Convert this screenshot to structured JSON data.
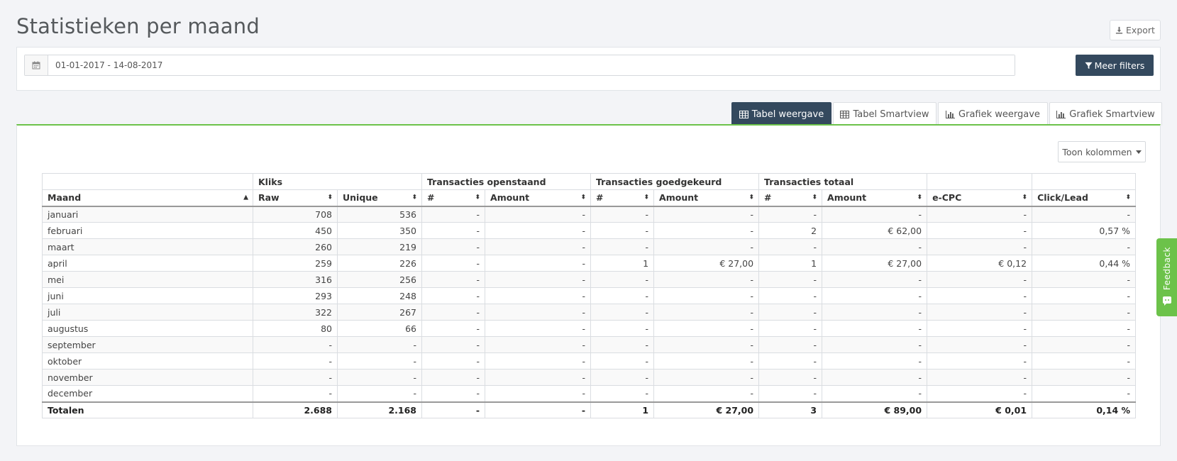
{
  "page": {
    "title": "Statistieken per maand",
    "export_label": "Export"
  },
  "filters": {
    "date_range": "01-01-2017 - 14-08-2017",
    "more_filters_label": "Meer filters"
  },
  "tabs": [
    {
      "label": "Tabel weergave",
      "icon": "table-icon",
      "active": true
    },
    {
      "label": "Tabel Smartview",
      "icon": "table-icon",
      "active": false
    },
    {
      "label": "Grafiek weergave",
      "icon": "bar-chart-icon",
      "active": false
    },
    {
      "label": "Grafiek Smartview",
      "icon": "bar-chart-icon",
      "active": false
    }
  ],
  "columns_button_label": "Toon kolommen",
  "table": {
    "groups": {
      "kliks": "Kliks",
      "open": "Transacties openstaand",
      "approved": "Transacties goedgekeurd",
      "total": "Transacties totaal"
    },
    "headers": [
      "Maand",
      "Raw",
      "Unique",
      "#",
      "Amount",
      "#",
      "Amount",
      "#",
      "Amount",
      "e-CPC",
      "Click/Lead"
    ],
    "rows": [
      [
        "januari",
        "708",
        "536",
        "-",
        "-",
        "-",
        "-",
        "-",
        "-",
        "-",
        "-"
      ],
      [
        "februari",
        "450",
        "350",
        "-",
        "-",
        "-",
        "-",
        "2",
        "€ 62,00",
        "-",
        "0,57 %"
      ],
      [
        "maart",
        "260",
        "219",
        "-",
        "-",
        "-",
        "-",
        "-",
        "-",
        "-",
        "-"
      ],
      [
        "april",
        "259",
        "226",
        "-",
        "-",
        "1",
        "€ 27,00",
        "1",
        "€ 27,00",
        "€ 0,12",
        "0,44 %"
      ],
      [
        "mei",
        "316",
        "256",
        "-",
        "-",
        "-",
        "-",
        "-",
        "-",
        "-",
        "-"
      ],
      [
        "juni",
        "293",
        "248",
        "-",
        "-",
        "-",
        "-",
        "-",
        "-",
        "-",
        "-"
      ],
      [
        "juli",
        "322",
        "267",
        "-",
        "-",
        "-",
        "-",
        "-",
        "-",
        "-",
        "-"
      ],
      [
        "augustus",
        "80",
        "66",
        "-",
        "-",
        "-",
        "-",
        "-",
        "-",
        "-",
        "-"
      ],
      [
        "september",
        "-",
        "-",
        "-",
        "-",
        "-",
        "-",
        "-",
        "-",
        "-",
        "-"
      ],
      [
        "oktober",
        "-",
        "-",
        "-",
        "-",
        "-",
        "-",
        "-",
        "-",
        "-",
        "-"
      ],
      [
        "november",
        "-",
        "-",
        "-",
        "-",
        "-",
        "-",
        "-",
        "-",
        "-",
        "-"
      ],
      [
        "december",
        "-",
        "-",
        "-",
        "-",
        "-",
        "-",
        "-",
        "-",
        "-",
        "-"
      ]
    ],
    "totals": [
      "Totalen",
      "2.688",
      "2.168",
      "-",
      "-",
      "1",
      "€ 27,00",
      "3",
      "€ 89,00",
      "€ 0,01",
      "0,14 %"
    ]
  },
  "feedback_label": "Feedback",
  "colors": {
    "primary": "#34495e",
    "accent_green": "#6cc24a"
  }
}
